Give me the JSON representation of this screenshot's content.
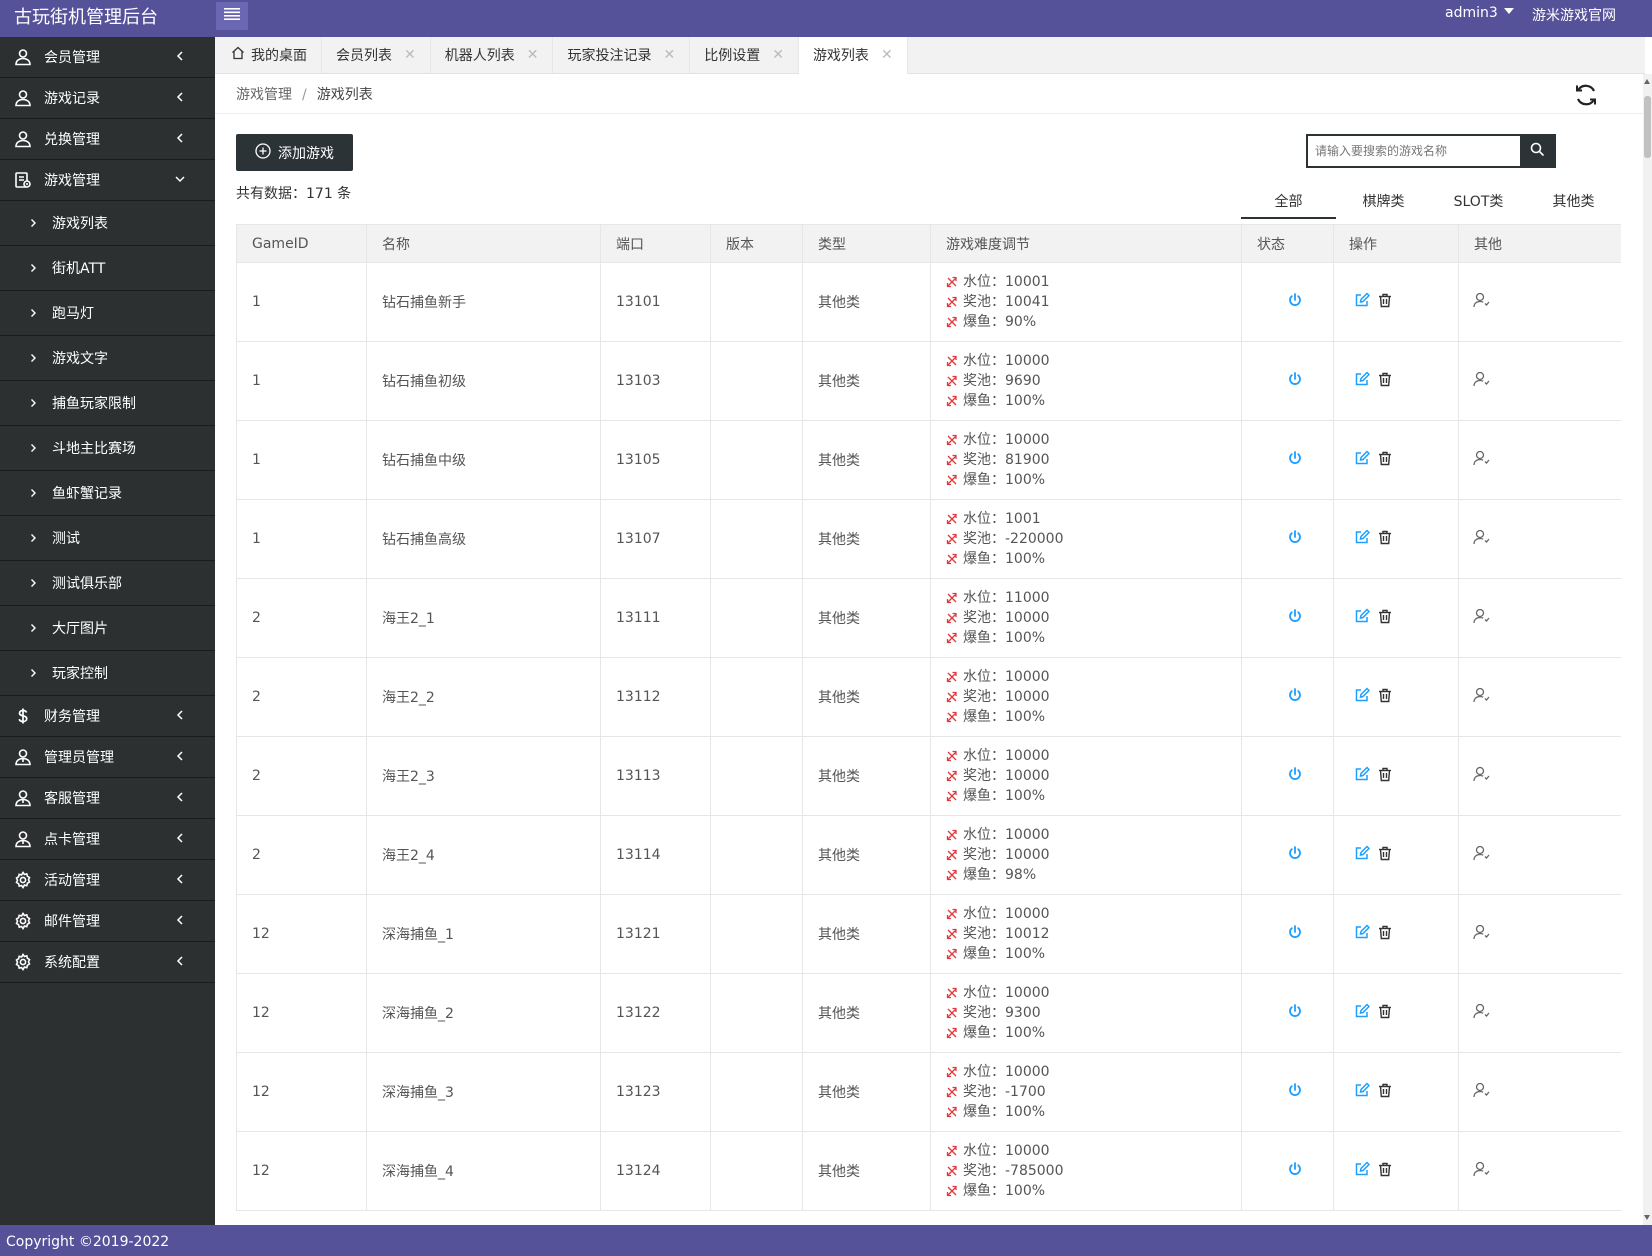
{
  "app": {
    "brand": "古玩街机管理后台",
    "user": "admin3",
    "site_link": "游米游戏官网",
    "copyright": "Copyright ©2019-2022"
  },
  "colors": {
    "accent": "#56529a",
    "sidebar_bg": "#2d3031",
    "dark_button": "#2b3337",
    "type_green": "#1aac19",
    "status_blue": "#1e9fff",
    "difficulty_red": "#e23a3a"
  },
  "sidebar": {
    "top_items": [
      {
        "label": "会员管理",
        "icon": "user-icon"
      },
      {
        "label": "游戏记录",
        "icon": "user-icon"
      },
      {
        "label": "兑换管理",
        "icon": "user-icon"
      }
    ],
    "expanded": {
      "label": "游戏管理",
      "icon": "game-manage-icon"
    },
    "sub_items": [
      {
        "label": "游戏列表"
      },
      {
        "label": "街机ATT"
      },
      {
        "label": "跑马灯"
      },
      {
        "label": "游戏文字"
      },
      {
        "label": "捕鱼玩家限制"
      },
      {
        "label": "斗地主比赛场"
      },
      {
        "label": "鱼虾蟹记录"
      },
      {
        "label": "测试"
      },
      {
        "label": "测试俱乐部"
      },
      {
        "label": "大厅图片"
      },
      {
        "label": "玩家控制"
      }
    ],
    "bottom_items": [
      {
        "label": "财务管理",
        "icon": "dollar-icon"
      },
      {
        "label": "管理员管理",
        "icon": "admin-user-icon"
      },
      {
        "label": "客服管理",
        "icon": "admin-user-icon"
      },
      {
        "label": "点卡管理",
        "icon": "admin-user-icon"
      },
      {
        "label": "活动管理",
        "icon": "gear-icon"
      },
      {
        "label": "邮件管理",
        "icon": "gear-icon"
      },
      {
        "label": "系统配置",
        "icon": "gear-icon"
      }
    ]
  },
  "tabs": [
    {
      "label": "我的桌面",
      "home": true,
      "closable": false,
      "active": false
    },
    {
      "label": "会员列表",
      "closable": true,
      "active": false
    },
    {
      "label": "机器人列表",
      "closable": true,
      "active": false
    },
    {
      "label": "玩家投注记录",
      "closable": true,
      "active": false
    },
    {
      "label": "比例设置",
      "closable": true,
      "active": false
    },
    {
      "label": "游戏列表",
      "closable": true,
      "active": true
    }
  ],
  "breadcrumb": {
    "parent": "游戏管理",
    "separator": "/",
    "current": "游戏列表"
  },
  "toolbar": {
    "add_label": "添加游戏",
    "total_text": "共有数据：171 条",
    "search_placeholder": "请输入要搜索的游戏名称"
  },
  "category_tabs": [
    {
      "label": "全部",
      "active": true
    },
    {
      "label": "棋牌类",
      "active": false
    },
    {
      "label": "SLOT类",
      "active": false
    },
    {
      "label": "其他类",
      "active": false
    }
  ],
  "table": {
    "columns": [
      "GameID",
      "名称",
      "端口",
      "版本",
      "类型",
      "游戏难度调节",
      "状态",
      "操作",
      "其他"
    ],
    "difficulty_labels": {
      "water": "水位：",
      "pool": "奖池：",
      "fish": "爆鱼："
    },
    "rows": [
      {
        "id": "1",
        "name": "钻石捕鱼新手",
        "port": "13101",
        "version": "",
        "type": "其他类",
        "water": "10001",
        "pool": "10041",
        "fish": "90%"
      },
      {
        "id": "1",
        "name": "钻石捕鱼初级",
        "port": "13103",
        "version": "",
        "type": "其他类",
        "water": "10000",
        "pool": "9690",
        "fish": "100%"
      },
      {
        "id": "1",
        "name": "钻石捕鱼中级",
        "port": "13105",
        "version": "",
        "type": "其他类",
        "water": "10000",
        "pool": "81900",
        "fish": "100%"
      },
      {
        "id": "1",
        "name": "钻石捕鱼高级",
        "port": "13107",
        "version": "",
        "type": "其他类",
        "water": "1001",
        "pool": "-220000",
        "fish": "100%"
      },
      {
        "id": "2",
        "name": "海王2_1",
        "port": "13111",
        "version": "",
        "type": "其他类",
        "water": "11000",
        "pool": "10000",
        "fish": "100%"
      },
      {
        "id": "2",
        "name": "海王2_2",
        "port": "13112",
        "version": "",
        "type": "其他类",
        "water": "10000",
        "pool": "10000",
        "fish": "100%"
      },
      {
        "id": "2",
        "name": "海王2_3",
        "port": "13113",
        "version": "",
        "type": "其他类",
        "water": "10000",
        "pool": "10000",
        "fish": "100%"
      },
      {
        "id": "2",
        "name": "海王2_4",
        "port": "13114",
        "version": "",
        "type": "其他类",
        "water": "10000",
        "pool": "10000",
        "fish": "98%"
      },
      {
        "id": "12",
        "name": "深海捕鱼_1",
        "port": "13121",
        "version": "",
        "type": "其他类",
        "water": "10000",
        "pool": "10012",
        "fish": "100%"
      },
      {
        "id": "12",
        "name": "深海捕鱼_2",
        "port": "13122",
        "version": "",
        "type": "其他类",
        "water": "10000",
        "pool": "9300",
        "fish": "100%"
      },
      {
        "id": "12",
        "name": "深海捕鱼_3",
        "port": "13123",
        "version": "",
        "type": "其他类",
        "water": "10000",
        "pool": "-1700",
        "fish": "100%"
      },
      {
        "id": "12",
        "name": "深海捕鱼_4",
        "port": "13124",
        "version": "",
        "type": "其他类",
        "water": "10000",
        "pool": "-785000",
        "fish": "100%"
      }
    ]
  }
}
